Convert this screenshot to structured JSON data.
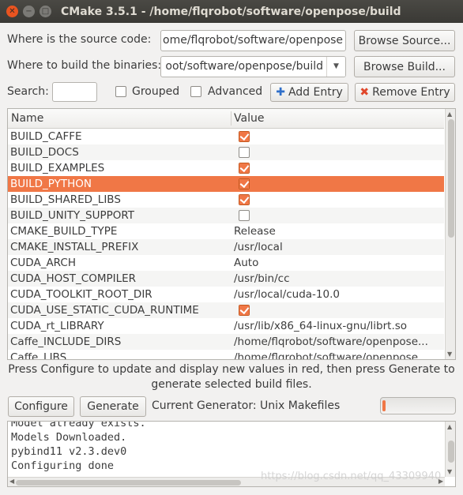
{
  "window": {
    "title": "CMake 3.5.1 - /home/flqrobot/software/openpose/build"
  },
  "source": {
    "label": "Where is the source code:",
    "value": "ome/flqrobot/software/openpose",
    "browse_label": "Browse Source..."
  },
  "binaries": {
    "label": "Where to build the binaries:",
    "value": "oot/software/openpose/build",
    "browse_label": "Browse Build..."
  },
  "toolbar": {
    "search_label": "Search:",
    "search_value": "",
    "grouped_label": "Grouped",
    "grouped_checked": false,
    "advanced_label": "Advanced",
    "advanced_checked": false,
    "add_entry_label": "Add Entry",
    "remove_entry_label": "Remove Entry"
  },
  "table": {
    "col_name": "Name",
    "col_value": "Value",
    "rows": [
      {
        "name": "BUILD_CAFFE",
        "type": "bool",
        "checked": true
      },
      {
        "name": "BUILD_DOCS",
        "type": "bool",
        "checked": false
      },
      {
        "name": "BUILD_EXAMPLES",
        "type": "bool",
        "checked": true
      },
      {
        "name": "BUILD_PYTHON",
        "type": "bool",
        "checked": true,
        "selected": true
      },
      {
        "name": "BUILD_SHARED_LIBS",
        "type": "bool",
        "checked": true
      },
      {
        "name": "BUILD_UNITY_SUPPORT",
        "type": "bool",
        "checked": false
      },
      {
        "name": "CMAKE_BUILD_TYPE",
        "type": "text",
        "value": "Release"
      },
      {
        "name": "CMAKE_INSTALL_PREFIX",
        "type": "text",
        "value": "/usr/local"
      },
      {
        "name": "CUDA_ARCH",
        "type": "text",
        "value": "Auto"
      },
      {
        "name": "CUDA_HOST_COMPILER",
        "type": "text",
        "value": "/usr/bin/cc"
      },
      {
        "name": "CUDA_TOOLKIT_ROOT_DIR",
        "type": "text",
        "value": "/usr/local/cuda-10.0"
      },
      {
        "name": "CUDA_USE_STATIC_CUDA_RUNTIME",
        "type": "bool",
        "checked": true
      },
      {
        "name": "CUDA_rt_LIBRARY",
        "type": "text",
        "value": "/usr/lib/x86_64-linux-gnu/librt.so"
      },
      {
        "name": "Caffe_INCLUDE_DIRS",
        "type": "text",
        "value": "/home/flqrobot/software/openpose..."
      },
      {
        "name": "Caffe_LIBS",
        "type": "text",
        "value": "/home/flqrobot/software/openpose..."
      }
    ]
  },
  "message": {
    "line1": "Press Configure to update and display new values in red, then press Generate to",
    "line2": "generate selected build files."
  },
  "actions": {
    "configure_label": "Configure",
    "generate_label": "Generate",
    "generator_text": "Current Generator: Unix Makefiles",
    "progress": 0.03
  },
  "output": {
    "lines": [
      "Model already exists.",
      "Models Downloaded.",
      "pybind11 v2.3.dev0",
      "Configuring done"
    ]
  },
  "watermark": "https://blog.csdn.net/qq_43309940",
  "colors": {
    "accent": "#f07746",
    "titlebar": "#3c3b37",
    "close": "#e95420"
  }
}
